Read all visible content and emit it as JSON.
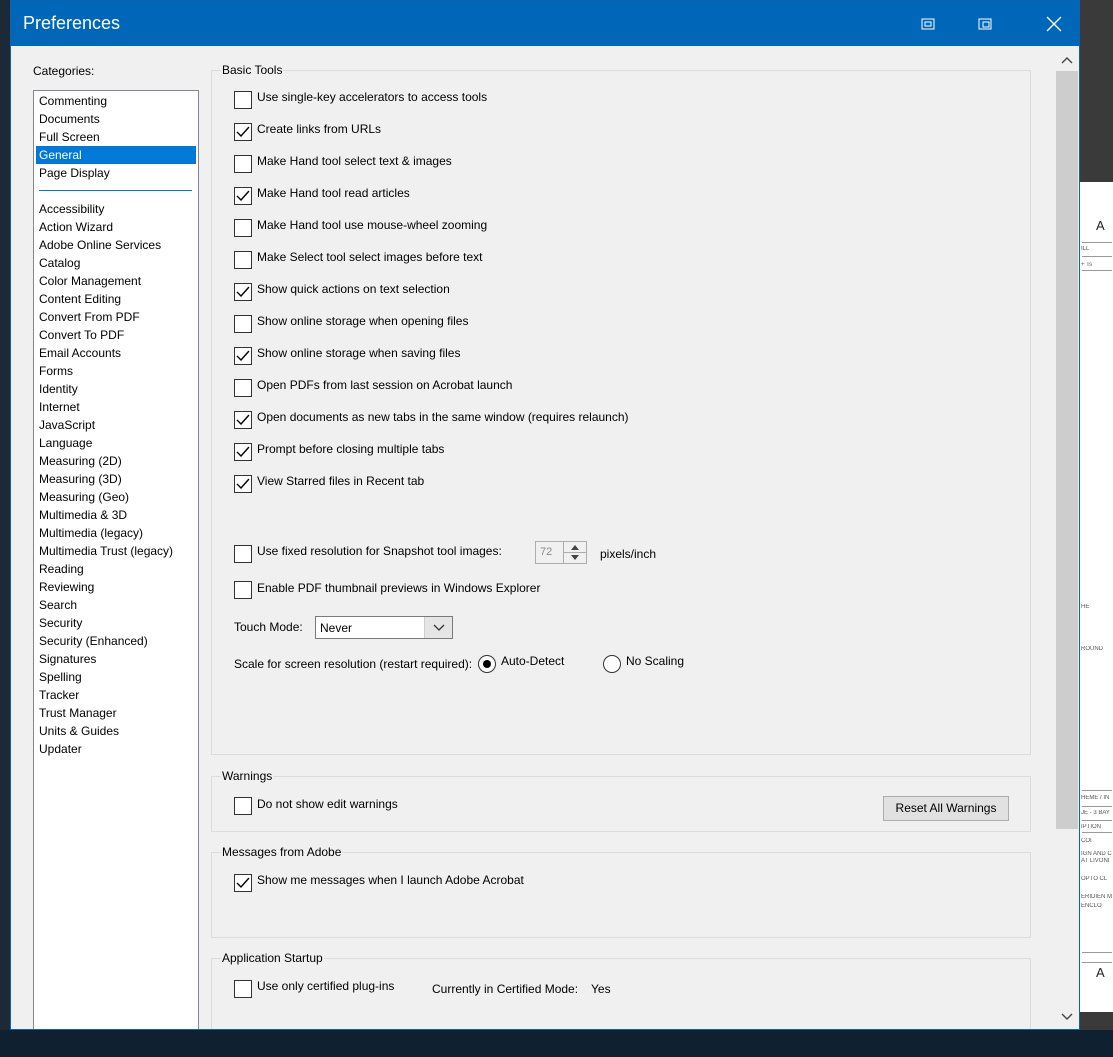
{
  "window": {
    "title": "Preferences"
  },
  "categories": {
    "label": "Categories:",
    "top_items": [
      "Commenting",
      "Documents",
      "Full Screen",
      "General",
      "Page Display"
    ],
    "selected": "General",
    "items": [
      "Accessibility",
      "Action Wizard",
      "Adobe Online Services",
      "Catalog",
      "Color Management",
      "Content Editing",
      "Convert From PDF",
      "Convert To PDF",
      "Email Accounts",
      "Forms",
      "Identity",
      "Internet",
      "JavaScript",
      "Language",
      "Measuring (2D)",
      "Measuring (3D)",
      "Measuring (Geo)",
      "Multimedia & 3D",
      "Multimedia (legacy)",
      "Multimedia Trust (legacy)",
      "Reading",
      "Reviewing",
      "Search",
      "Security",
      "Security (Enhanced)",
      "Signatures",
      "Spelling",
      "Tracker",
      "Trust Manager",
      "Units & Guides",
      "Updater"
    ]
  },
  "basic_tools": {
    "title": "Basic Tools",
    "options": [
      {
        "label": "Use single-key accelerators to access tools",
        "checked": false
      },
      {
        "label": "Create links from URLs",
        "checked": true
      },
      {
        "label": "Make Hand tool select text & images",
        "checked": false
      },
      {
        "label": "Make Hand tool read articles",
        "checked": true
      },
      {
        "label": "Make Hand tool use mouse-wheel zooming",
        "checked": false
      },
      {
        "label": "Make Select tool select images before text",
        "checked": false
      },
      {
        "label": "Show quick actions on text selection",
        "checked": true
      },
      {
        "label": "Show online storage when opening files",
        "checked": false
      },
      {
        "label": "Show online storage when saving files",
        "checked": true
      },
      {
        "label": "Open PDFs from last session on Acrobat launch",
        "checked": false
      },
      {
        "label": "Open documents as new tabs in the same window (requires relaunch)",
        "checked": true
      },
      {
        "label": "Prompt before closing multiple tabs",
        "checked": true
      },
      {
        "label": "View Starred files in Recent tab",
        "checked": true
      }
    ],
    "snapshot": {
      "label": "Use fixed resolution for Snapshot tool images:",
      "checked": false,
      "value": "72",
      "unit": "pixels/inch"
    },
    "thumbnail": {
      "label": "Enable PDF thumbnail previews in Windows Explorer",
      "checked": false
    },
    "touch_mode": {
      "label": "Touch Mode:",
      "value": "Never"
    },
    "scale": {
      "label": "Scale for screen resolution (restart required):",
      "options": [
        "Auto-Detect",
        "No Scaling"
      ],
      "selected": "Auto-Detect"
    }
  },
  "warnings": {
    "title": "Warnings",
    "option": {
      "label": "Do not show edit warnings",
      "checked": false
    },
    "reset_button": "Reset All Warnings"
  },
  "messages": {
    "title": "Messages from Adobe",
    "option": {
      "label": "Show me messages when I launch Adobe Acrobat",
      "checked": true
    }
  },
  "startup": {
    "title": "Application Startup",
    "option": {
      "label": "Use only certified plug-ins",
      "checked": false
    },
    "certified_label": "Currently in Certified Mode:",
    "certified_value": "Yes"
  },
  "background_doc": {
    "lines": [
      "ILL",
      "+ Ts",
      "HE",
      "ROUND",
      "HEME / IN",
      "JE - 3 BAY",
      "IPTION",
      "COI",
      "IGN AND C",
      "AT LIVONI",
      "OPTO CL",
      "ERIDIEN M",
      "ENCLO"
    ],
    "letter_top": "A",
    "letter_bottom": "A"
  },
  "colors": {
    "titlebar": "#0067b8",
    "selection": "#0078d7",
    "window_bg": "#f0f0f0"
  }
}
